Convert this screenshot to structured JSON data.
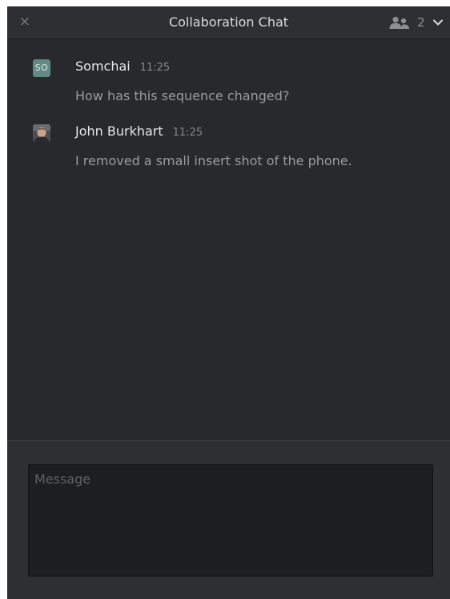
{
  "window": {
    "title": "Collaboration Chat",
    "close_icon": "×",
    "users_icon": "users-icon",
    "user_count": "2",
    "chevron_icon": "chevron-down-icon"
  },
  "messages": [
    {
      "avatar_text": "SO",
      "avatar_type": "initials",
      "author": "Somchai",
      "time": "11:25",
      "text": "How has this sequence changed?"
    },
    {
      "avatar_text": "",
      "avatar_type": "photo",
      "author": "John Burkhart",
      "time": "11:25",
      "text": "I removed a small insert shot of the phone."
    }
  ],
  "compose": {
    "placeholder": "Message",
    "value": ""
  },
  "colors": {
    "background": "#28292d",
    "titlebar": "#2e2f33",
    "input_bg": "#1d1e21",
    "avatar_so": "#5f8a86"
  }
}
